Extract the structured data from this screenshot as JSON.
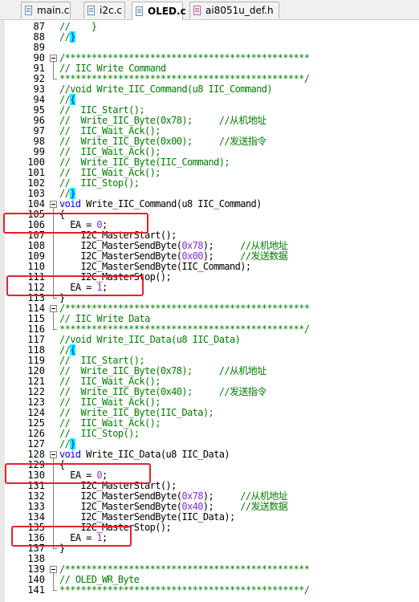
{
  "tabs": [
    {
      "label": "main.c",
      "icon": "c-file-icon"
    },
    {
      "label": "i2c.c",
      "icon": "c-file-icon"
    },
    {
      "label": "OLED.c",
      "icon": "c-file-icon",
      "active": true
    },
    {
      "label": "ai8051u_def.h",
      "icon": "h-file-icon"
    }
  ],
  "lines": [
    {
      "n": "87",
      "t": "//    }"
    },
    {
      "n": "88",
      "t": "//}"
    },
    {
      "n": "89",
      "t": ""
    },
    {
      "n": "90",
      "t": "/**********************************************"
    },
    {
      "n": "91",
      "t": "// IIC Write Command"
    },
    {
      "n": "92",
      "t": "**********************************************/"
    },
    {
      "n": "93",
      "t": "//void Write_IIC_Command(u8 IIC_Command)"
    },
    {
      "n": "94",
      "t": "//{"
    },
    {
      "n": "95",
      "t": "//  IIC_Start();"
    },
    {
      "n": "96",
      "t": "//  Write_IIC_Byte(0x78);     //从机地址"
    },
    {
      "n": "97",
      "t": "//  IIC_Wait_Ack();"
    },
    {
      "n": "98",
      "t": "//  Write_IIC_Byte(0x00);     //发送指令"
    },
    {
      "n": "99",
      "t": "//  IIC_Wait_Ack();"
    },
    {
      "n": "100",
      "t": "//  Write_IIC_Byte(IIC_Command);"
    },
    {
      "n": "101",
      "t": "//  IIC_Wait_Ack();"
    },
    {
      "n": "102",
      "t": "//  IIC_Stop();"
    },
    {
      "n": "103",
      "t": "//}"
    },
    {
      "n": "104",
      "t": "void Write_IIC_Command(u8 IIC_Command)"
    },
    {
      "n": "105",
      "t": "{"
    },
    {
      "n": "106",
      "t": "  EA = 0;"
    },
    {
      "n": "107",
      "t": "    I2C_MasterStart();"
    },
    {
      "n": "108",
      "t": "    I2C_MasterSendByte(0x78);     //从机地址"
    },
    {
      "n": "109",
      "t": "    I2C_MasterSendByte(0x00);     //发送数据"
    },
    {
      "n": "110",
      "t": "    I2C_MasterSendByte(IIC_Command);"
    },
    {
      "n": "111",
      "t": "    I2C_MasterStop();"
    },
    {
      "n": "112",
      "t": "  EA = 1;"
    },
    {
      "n": "113",
      "t": "}"
    },
    {
      "n": "114",
      "t": "/**********************************************"
    },
    {
      "n": "115",
      "t": "// IIC Write Data"
    },
    {
      "n": "116",
      "t": "**********************************************/"
    },
    {
      "n": "117",
      "t": "//void Write_IIC_Data(u8 IIC_Data)"
    },
    {
      "n": "118",
      "t": "//{"
    },
    {
      "n": "119",
      "t": "//  IIC_Start();"
    },
    {
      "n": "120",
      "t": "//  Write_IIC_Byte(0x78);     //从机地址"
    },
    {
      "n": "121",
      "t": "//  IIC_Wait_Ack();"
    },
    {
      "n": "122",
      "t": "//  Write_IIC_Byte(0x40);     //发送指令"
    },
    {
      "n": "123",
      "t": "//  IIC_Wait_Ack();"
    },
    {
      "n": "124",
      "t": "//  Write_IIC_Byte(IIC_Data);"
    },
    {
      "n": "125",
      "t": "//  IIC_Wait_Ack();"
    },
    {
      "n": "126",
      "t": "//  IIC_Stop();"
    },
    {
      "n": "127",
      "t": "//}"
    },
    {
      "n": "128",
      "t": "void Write_IIC_Data(u8 IIC_Data)"
    },
    {
      "n": "129",
      "t": "{"
    },
    {
      "n": "130",
      "t": "  EA = 0;"
    },
    {
      "n": "131",
      "t": "    I2C_MasterStart();"
    },
    {
      "n": "132",
      "t": "    I2C_MasterSendByte(0x78);     //从机地址"
    },
    {
      "n": "133",
      "t": "    I2C_MasterSendByte(0x40);     //发送数据"
    },
    {
      "n": "134",
      "t": "    I2C_MasterSendByte(IIC_Data);"
    },
    {
      "n": "135",
      "t": "    I2C_MasterStop();"
    },
    {
      "n": "136",
      "t": "  EA = 1;"
    },
    {
      "n": "137",
      "t": "}"
    },
    {
      "n": "138",
      "t": ""
    },
    {
      "n": "139",
      "t": "/**********************************************"
    },
    {
      "n": "140",
      "t": "// OLED_WR_Byte"
    },
    {
      "n": "141",
      "t": "**********************************************/"
    }
  ],
  "highlight_color": "#e8202a",
  "colors": {
    "comment": "#008000",
    "keyword": "#0000ff",
    "number": "#8a2be2",
    "brace_match": "#00ffff"
  }
}
